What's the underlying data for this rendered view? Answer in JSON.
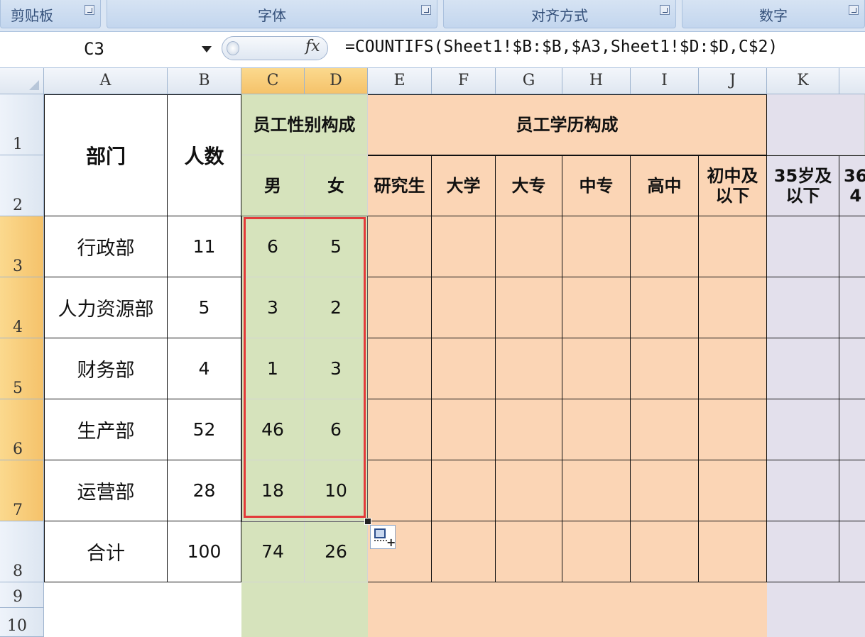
{
  "ribbon": {
    "groups": [
      "剪贴板",
      "字体",
      "对齐方式",
      "数字"
    ]
  },
  "formula_bar": {
    "name_box": "C3",
    "fx_label": "fx",
    "formula": "=COUNTIFS(Sheet1!$B:$B,$A3,Sheet1!$D:$D,C$2)"
  },
  "columns": [
    "A",
    "B",
    "C",
    "D",
    "E",
    "F",
    "G",
    "H",
    "I",
    "J",
    "K"
  ],
  "rows": [
    "1",
    "2",
    "3",
    "4",
    "5",
    "6",
    "7",
    "8",
    "9",
    "10"
  ],
  "headers": {
    "dept": "部门",
    "count": "人数",
    "gender_group": "员工性别构成",
    "male": "男",
    "female": "女",
    "edu_group": "员工学历构成",
    "edu": [
      "研究生",
      "大学",
      "大专",
      "中专",
      "高中",
      "初中及\n以下"
    ],
    "age_partial": [
      "35岁及\n以下",
      "36\n4"
    ]
  },
  "table": [
    {
      "dept": "行政部",
      "count": "11",
      "male": "6",
      "female": "5"
    },
    {
      "dept": "人力资源部",
      "count": "5",
      "male": "3",
      "female": "2"
    },
    {
      "dept": "财务部",
      "count": "4",
      "male": "1",
      "female": "3"
    },
    {
      "dept": "生产部",
      "count": "52",
      "male": "46",
      "female": "6"
    },
    {
      "dept": "运营部",
      "count": "28",
      "male": "18",
      "female": "10"
    }
  ],
  "total": {
    "dept": "合计",
    "count": "100",
    "male": "74",
    "female": "26"
  },
  "colors": {
    "gender_fill": "#d6e3bc",
    "edu_fill": "#fbd5b5",
    "age_fill": "#e3e0ec",
    "selection_border": "#e33a3a",
    "selected_header": "#f5c26a"
  }
}
